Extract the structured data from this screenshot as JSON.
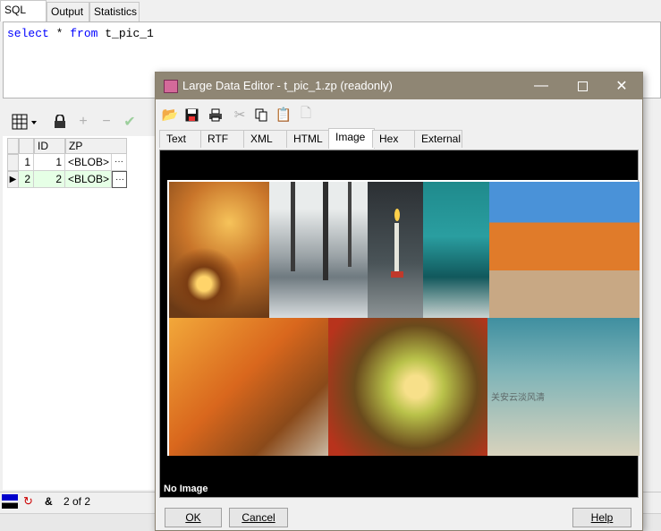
{
  "top_tabs": [
    {
      "label": "SQL"
    },
    {
      "label": "Output"
    },
    {
      "label": "Statistics"
    }
  ],
  "editor": {
    "keyword1": "select",
    "star": " * ",
    "keyword2": "from",
    "rest": " t_pic_1"
  },
  "grid": {
    "headers": {
      "id": "ID",
      "zp": "ZP"
    },
    "rows": [
      {
        "num": "1",
        "id": "1",
        "zp": "<BLOB>",
        "btn": "···"
      },
      {
        "num": "2",
        "id": "2",
        "zp": "<BLOB>",
        "btn": "···"
      }
    ]
  },
  "status": {
    "records": "2 of 2",
    "amp": "&"
  },
  "dialog": {
    "title": "Large Data Editor - t_pic_1.zp (readonly)",
    "tabs": [
      {
        "label": "Text"
      },
      {
        "label": "RTF"
      },
      {
        "label": "XML"
      },
      {
        "label": "HTML"
      },
      {
        "label": "Image"
      },
      {
        "label": "Hex"
      },
      {
        "label": "External"
      }
    ],
    "no_image": "No Image",
    "ok": "OK",
    "cancel": "Cancel",
    "help": "Help",
    "photo_text": "关安云淡风清"
  },
  "colors": {
    "titlebar": "#8f8674",
    "keyword": "#0000ff",
    "grid_selected": "#e6ffe6"
  }
}
